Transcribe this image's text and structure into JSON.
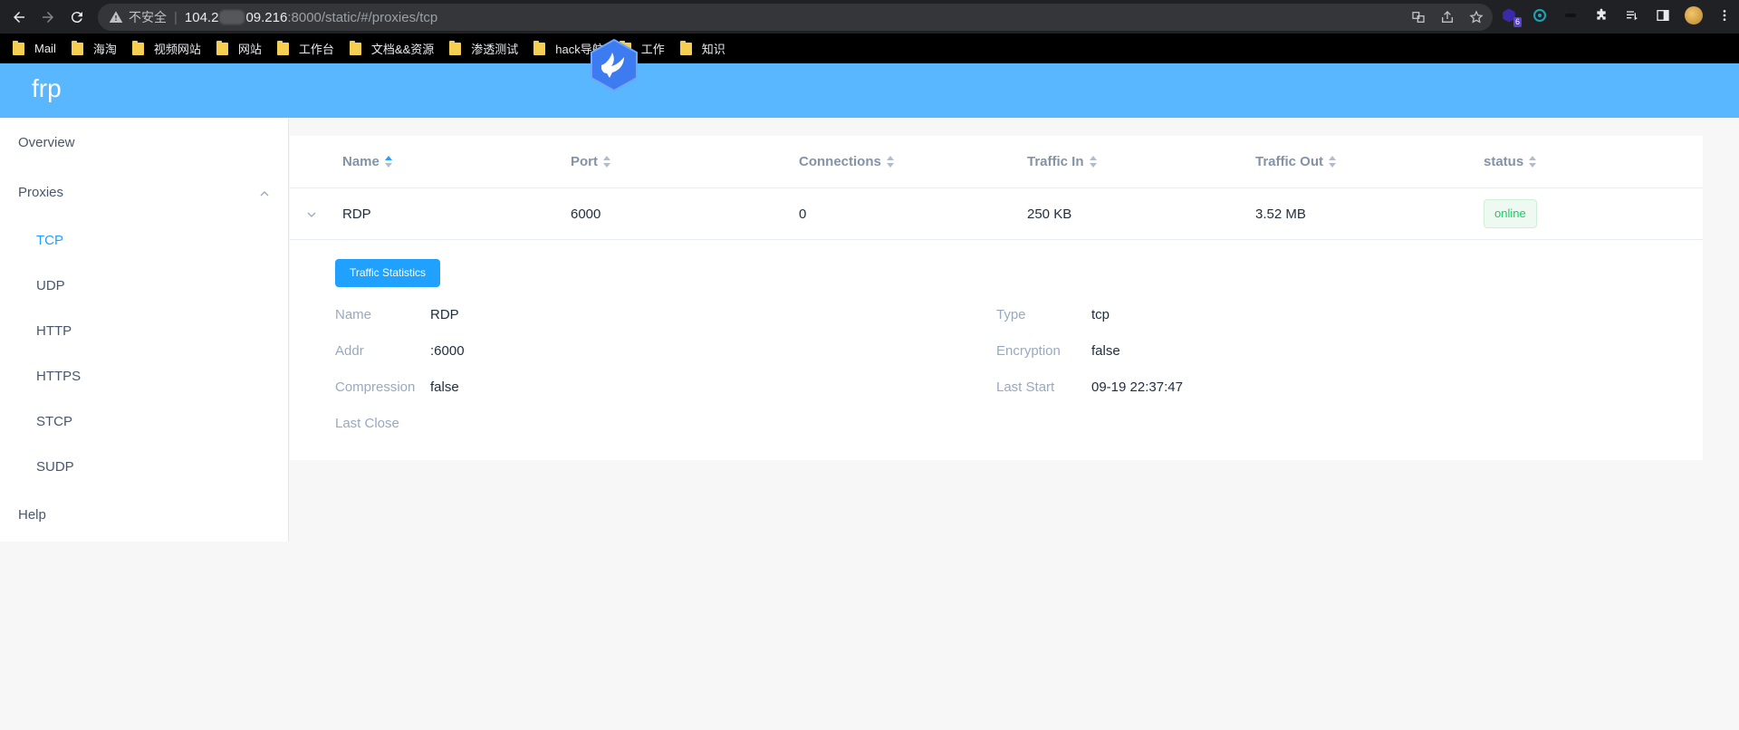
{
  "browser": {
    "insecure_label": "不安全",
    "url_host_prefix": "104.2",
    "url_host_suffix": "09.216",
    "url_rest": ":8000/static/#/proxies/tcp",
    "extension_badge": "6"
  },
  "bookmarks": [
    "Mail",
    "海淘",
    "视频网站",
    "网站",
    "工作台",
    "文档&&资源",
    "渗透测试",
    "hack导航",
    "工作",
    "知识"
  ],
  "app": {
    "title": "frp"
  },
  "sidebar": {
    "overview": "Overview",
    "proxies": "Proxies",
    "sub_items": [
      "TCP",
      "UDP",
      "HTTP",
      "HTTPS",
      "STCP",
      "SUDP"
    ],
    "active_item": "TCP",
    "help": "Help"
  },
  "table": {
    "columns": [
      "Name",
      "Port",
      "Connections",
      "Traffic In",
      "Traffic Out",
      "status"
    ],
    "sorted_column": "Name",
    "rows": [
      {
        "name": "RDP",
        "port": "6000",
        "connections": "0",
        "traffic_in": "250 KB",
        "traffic_out": "3.52 MB",
        "status": "online"
      }
    ]
  },
  "detail": {
    "button_label": "Traffic Statistics",
    "left": [
      {
        "label": "Name",
        "value": "RDP"
      },
      {
        "label": "Addr",
        "value": ":6000"
      },
      {
        "label": "Compression",
        "value": "false"
      },
      {
        "label": "Last Close",
        "value": ""
      }
    ],
    "right": [
      {
        "label": "Type",
        "value": "tcp"
      },
      {
        "label": "Encryption",
        "value": "false"
      },
      {
        "label": "Last Start",
        "value": "09-19 22:37:47"
      }
    ]
  },
  "colors": {
    "header_blue": "#58b7ff",
    "accent_blue": "#20a0ff",
    "online_green": "#13ce66"
  }
}
